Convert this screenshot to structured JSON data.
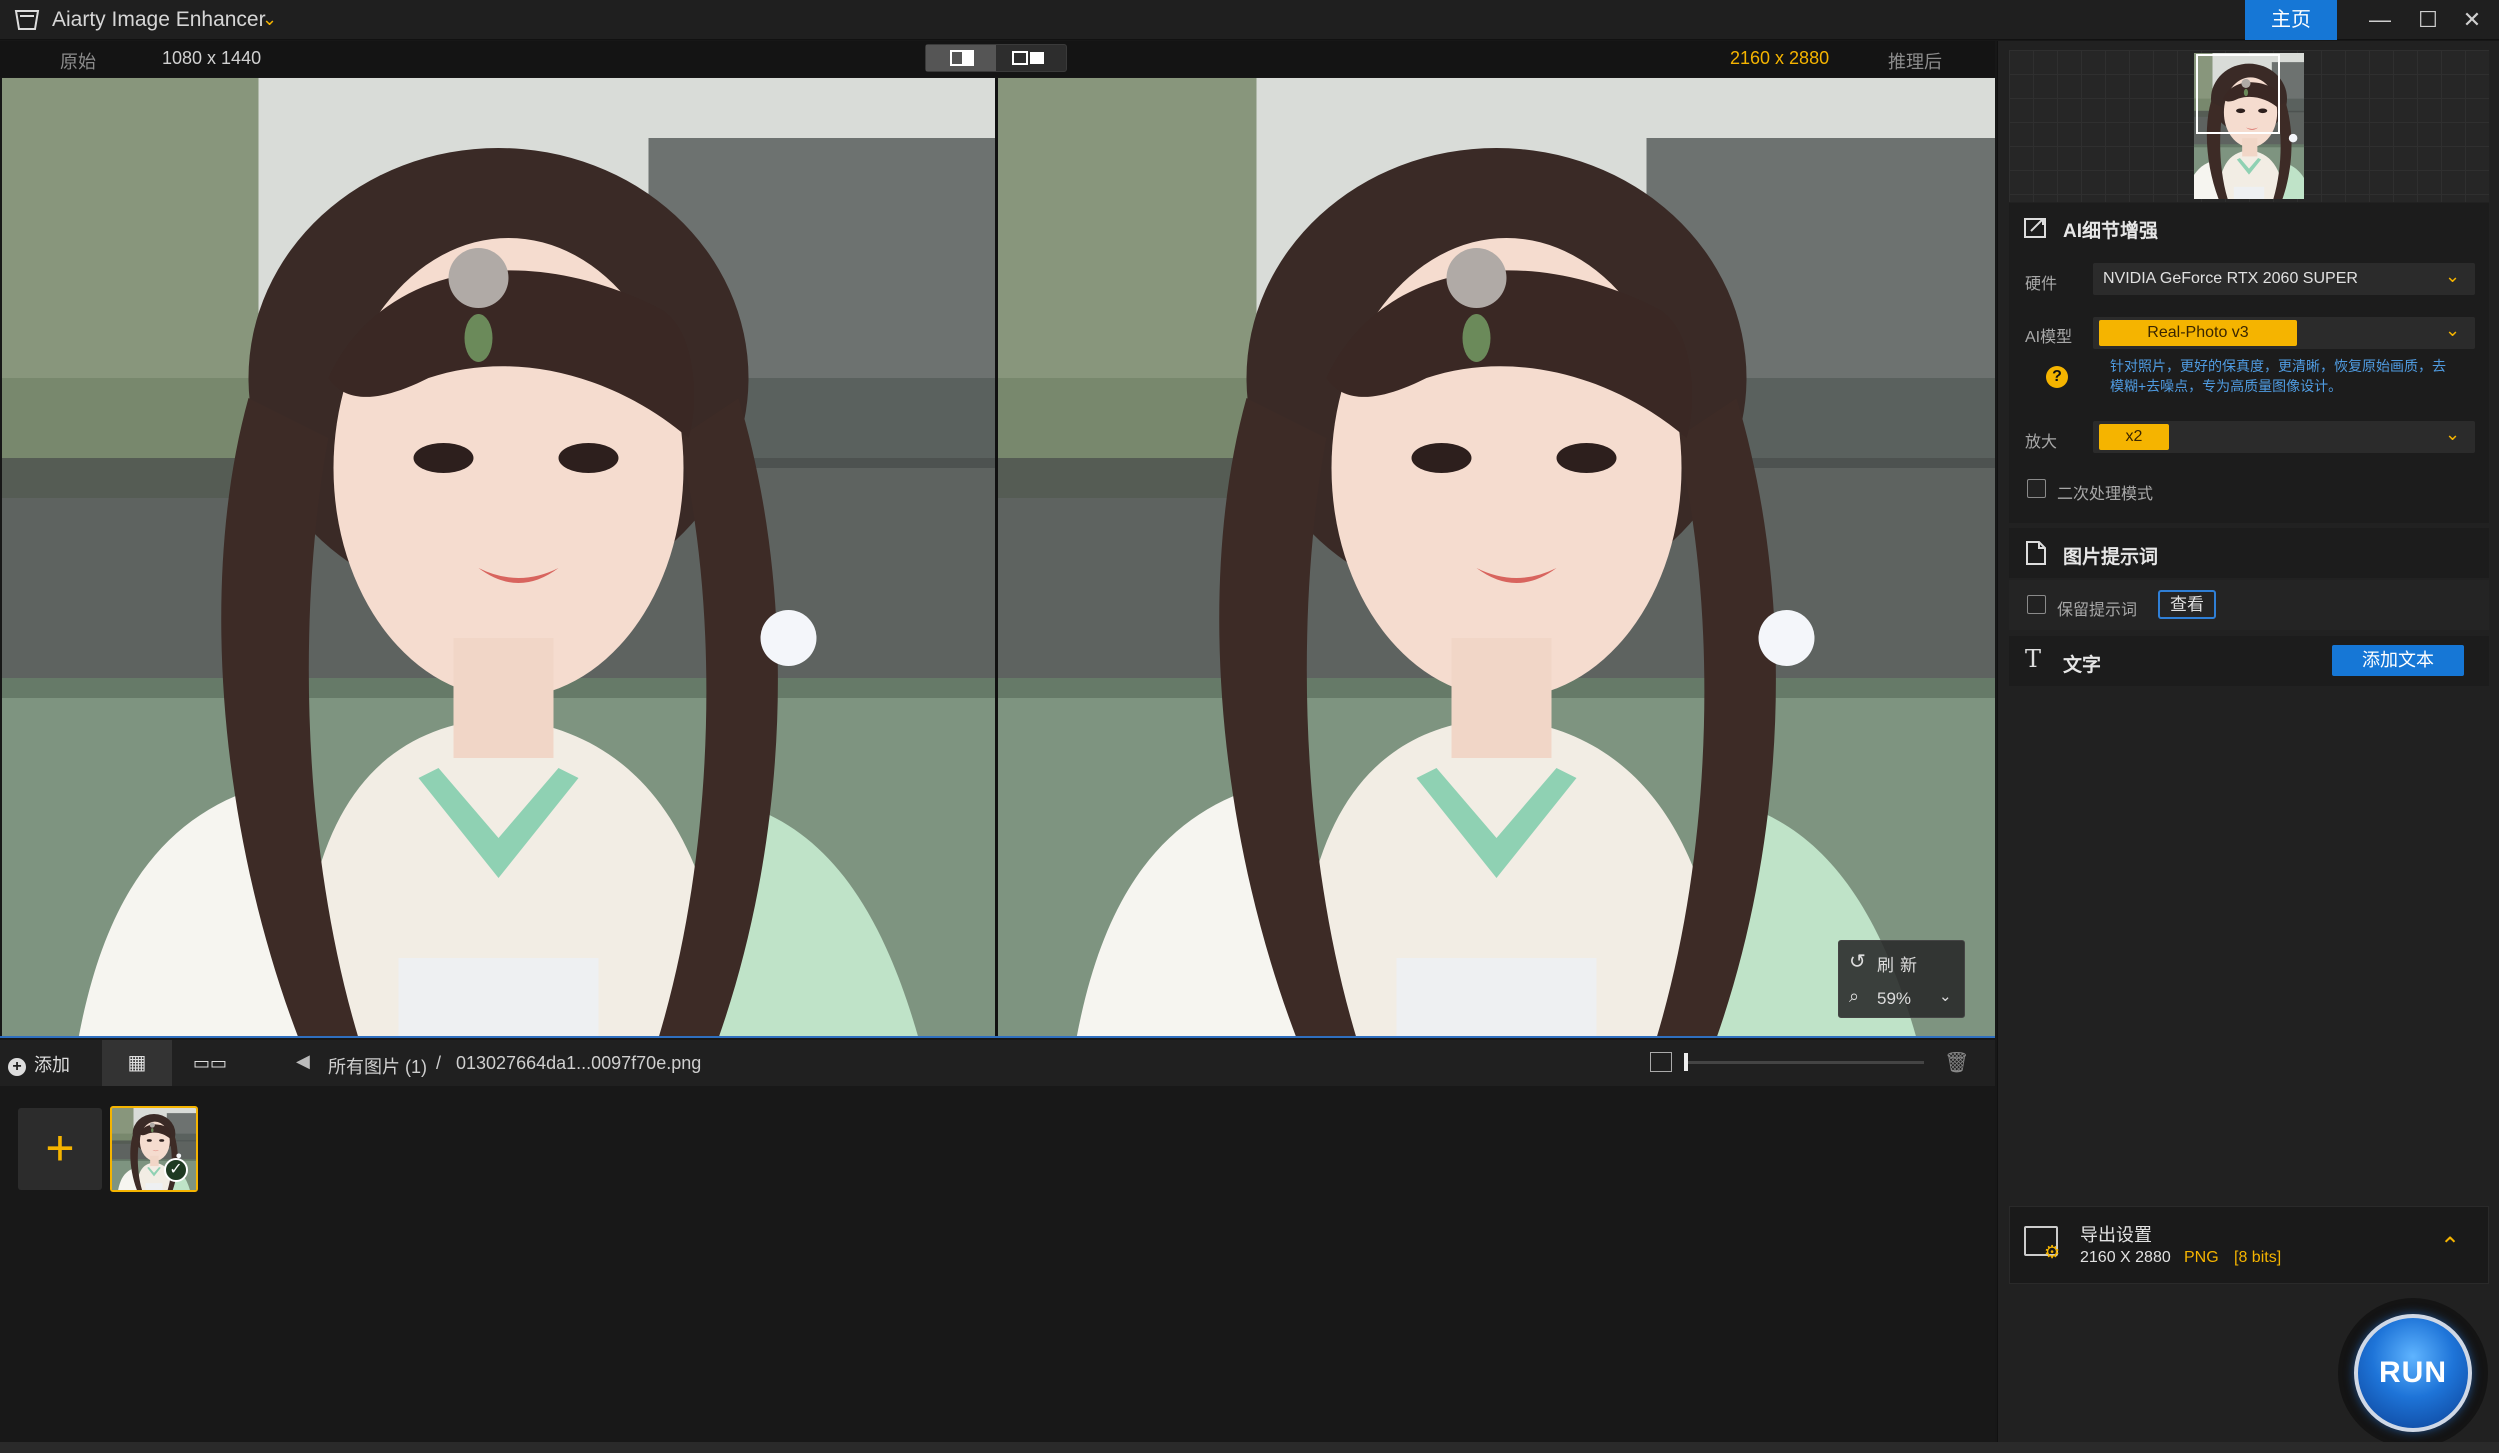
{
  "window": {
    "title": "Aiarty Image Enhancer",
    "home_label": "主页",
    "minimize_glyph": "—",
    "maximize_glyph": "☐",
    "close_glyph": "✕"
  },
  "compare": {
    "original_label": "原始",
    "original_size": "1080 x 1440",
    "result_size": "2160 x 2880",
    "result_label": "推理后",
    "refresh_label": "刷新",
    "zoom": "59%"
  },
  "toolbar": {
    "add_label": "添加",
    "breadcrumb_all": "所有图片 (1)",
    "breadcrumb_sep": "/",
    "breadcrumb_file": "013027664da1...0097f70e.png",
    "thumb_size": 0.0
  },
  "panel": {
    "ai_section": {
      "title": "AI细节增强",
      "hardware_label": "硬件",
      "hardware_value": "NVIDIA GeForce RTX 2060 SUPER",
      "model_label": "AI模型",
      "model_value": "Real-Photo v3",
      "model_desc": "针对照片，更好的保真度，更清晰，恢复原始画质，去模糊+去噪点，专为高质量图像设计。",
      "scale_label": "放大",
      "scale_value": "x2",
      "second_pass_label": "二次处理模式",
      "second_pass_checked": false
    },
    "prompt_section": {
      "title": "图片提示词",
      "keep_label": "保留提示词",
      "keep_checked": false,
      "view_label": "查看"
    },
    "text_section": {
      "title": "文字",
      "add_text_label": "添加文本"
    },
    "export": {
      "title": "导出设置",
      "size": "2160 X 2880",
      "format": "PNG",
      "bits": "[8 bits]"
    },
    "run_label": "RUN"
  },
  "colors": {
    "accent": "#f5b400",
    "primary_blue": "#1677d6",
    "desc_blue": "#4f9be0",
    "background": "#171717"
  },
  "icons": [
    "app-logo-icon",
    "chevron-down-icon",
    "refresh-icon",
    "zoom-icon",
    "add-icon",
    "grid-view-icon",
    "strip-view-icon",
    "back-arrow-icon",
    "image-size-icon",
    "trash-icon",
    "enhance-icon",
    "document-icon",
    "text-icon",
    "help-icon",
    "export-settings-icon",
    "expand-up-icon",
    "plus-icon",
    "check-icon"
  ]
}
